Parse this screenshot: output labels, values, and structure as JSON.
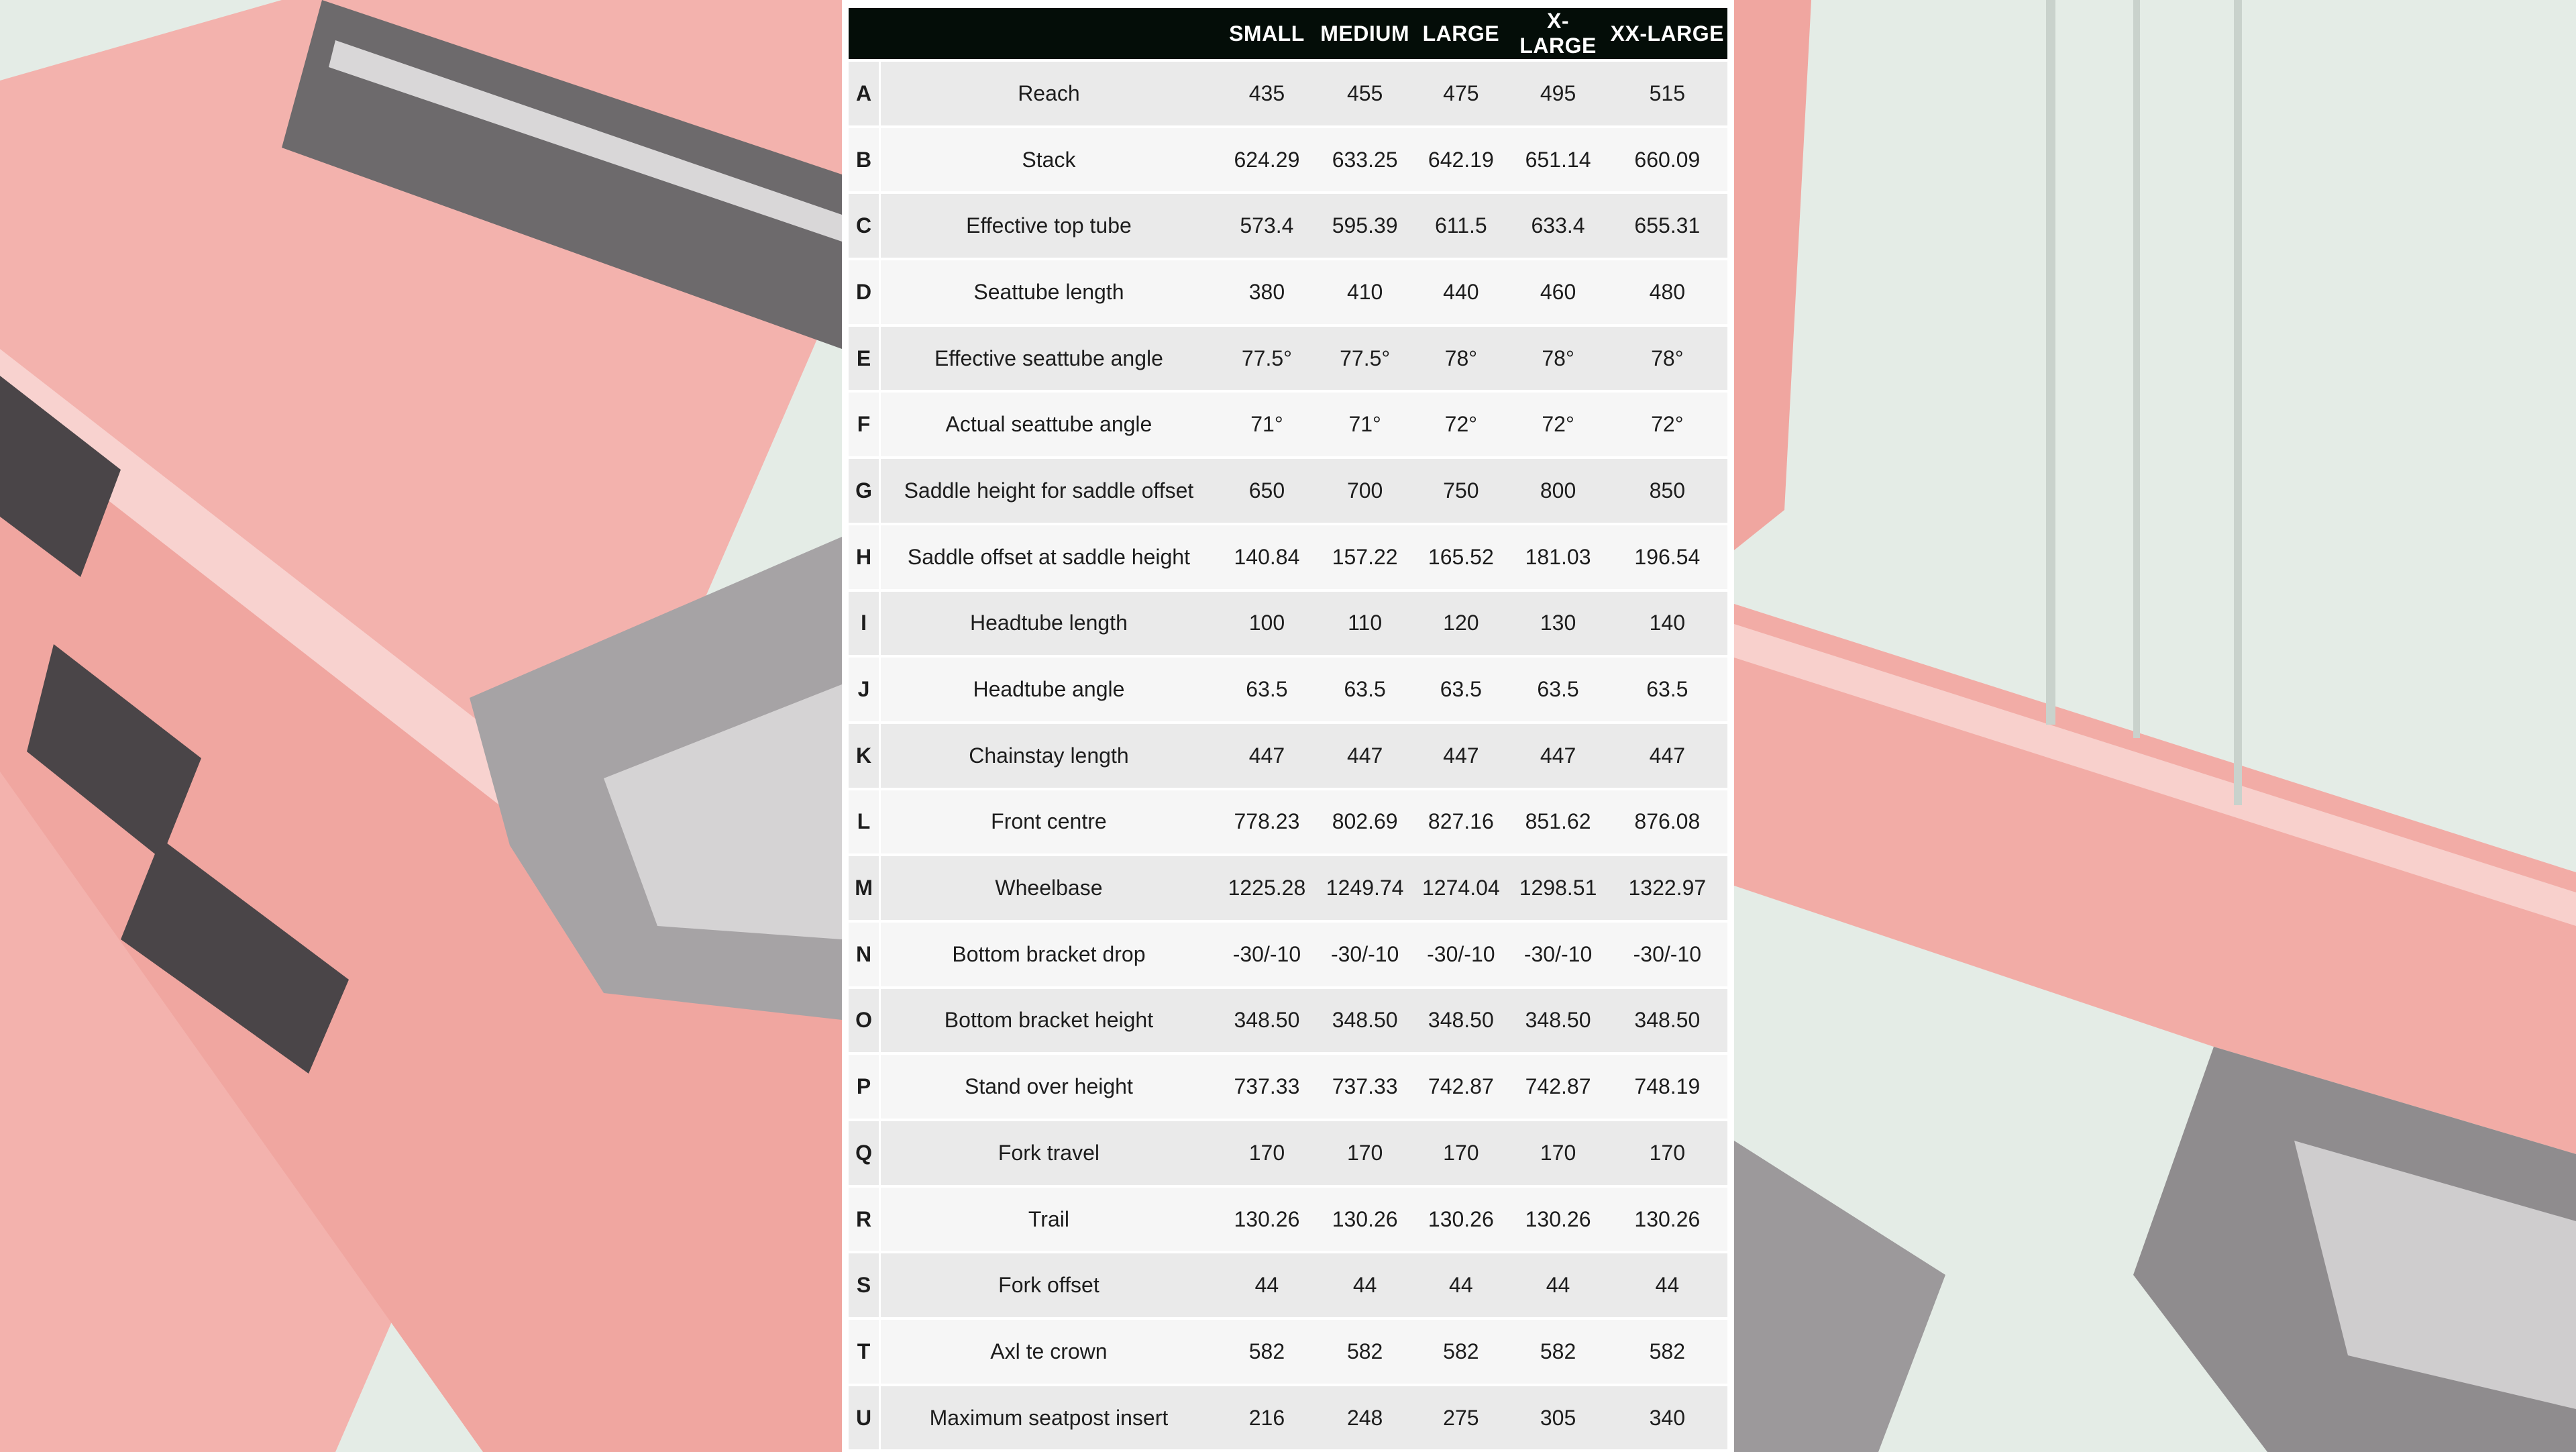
{
  "table": {
    "header": {
      "corner": "",
      "sizes": [
        "SMALL",
        "MEDIUM",
        "LARGE",
        "X-LARGE",
        "XX-LARGE"
      ]
    },
    "rows": [
      {
        "letter": "A",
        "label": "Reach",
        "values": [
          "435",
          "455",
          "475",
          "495",
          "515"
        ]
      },
      {
        "letter": "B",
        "label": "Stack",
        "values": [
          "624.29",
          "633.25",
          "642.19",
          "651.14",
          "660.09"
        ]
      },
      {
        "letter": "C",
        "label": "Effective top tube",
        "values": [
          "573.4",
          "595.39",
          "611.5",
          "633.4",
          "655.31"
        ]
      },
      {
        "letter": "D",
        "label": "Seattube length",
        "values": [
          "380",
          "410",
          "440",
          "460",
          "480"
        ]
      },
      {
        "letter": "E",
        "label": "Effective seattube angle",
        "values": [
          "77.5°",
          "77.5°",
          "78°",
          "78°",
          "78°"
        ]
      },
      {
        "letter": "F",
        "label": "Actual seattube angle",
        "values": [
          "71°",
          "71°",
          "72°",
          "72°",
          "72°"
        ]
      },
      {
        "letter": "G",
        "label": "Saddle height for saddle offset",
        "values": [
          "650",
          "700",
          "750",
          "800",
          "850"
        ]
      },
      {
        "letter": "H",
        "label": "Saddle offset at saddle height",
        "values": [
          "140.84",
          "157.22",
          "165.52",
          "181.03",
          "196.54"
        ]
      },
      {
        "letter": "I",
        "label": "Headtube length",
        "values": [
          "100",
          "110",
          "120",
          "130",
          "140"
        ]
      },
      {
        "letter": "J",
        "label": "Headtube angle",
        "values": [
          "63.5",
          "63.5",
          "63.5",
          "63.5",
          "63.5"
        ]
      },
      {
        "letter": "K",
        "label": "Chainstay length",
        "values": [
          "447",
          "447",
          "447",
          "447",
          "447"
        ]
      },
      {
        "letter": "L",
        "label": "Front centre",
        "values": [
          "778.23",
          "802.69",
          "827.16",
          "851.62",
          "876.08"
        ]
      },
      {
        "letter": "M",
        "label": "Wheelbase",
        "values": [
          "1225.28",
          "1249.74",
          "1274.04",
          "1298.51",
          "1322.97"
        ]
      },
      {
        "letter": "N",
        "label": "Bottom bracket drop",
        "values": [
          "-30/-10",
          "-30/-10",
          "-30/-10",
          "-30/-10",
          "-30/-10"
        ]
      },
      {
        "letter": "O",
        "label": "Bottom bracket height",
        "values": [
          "348.50",
          "348.50",
          "348.50",
          "348.50",
          "348.50"
        ]
      },
      {
        "letter": "P",
        "label": "Stand over height",
        "values": [
          "737.33",
          "737.33",
          "742.87",
          "742.87",
          "748.19"
        ]
      },
      {
        "letter": "Q",
        "label": "Fork travel",
        "values": [
          "170",
          "170",
          "170",
          "170",
          "170"
        ]
      },
      {
        "letter": "R",
        "label": "Trail",
        "values": [
          "130.26",
          "130.26",
          "130.26",
          "130.26",
          "130.26"
        ]
      },
      {
        "letter": "S",
        "label": "Fork offset",
        "values": [
          "44",
          "44",
          "44",
          "44",
          "44"
        ]
      },
      {
        "letter": "T",
        "label": "Axl te crown",
        "values": [
          "582",
          "582",
          "582",
          "582",
          "582"
        ]
      },
      {
        "letter": "U",
        "label": "Maximum seatpost insert",
        "values": [
          "216",
          "248",
          "275",
          "305",
          "340"
        ]
      }
    ]
  },
  "colors": {
    "header_background": "#040d08",
    "header_text": "#ffffff",
    "row_odd": "#eaeaea",
    "row_even": "#f6f6f6",
    "frame_pink": "#f2a9a4",
    "background_mint": "#e4ece6"
  }
}
